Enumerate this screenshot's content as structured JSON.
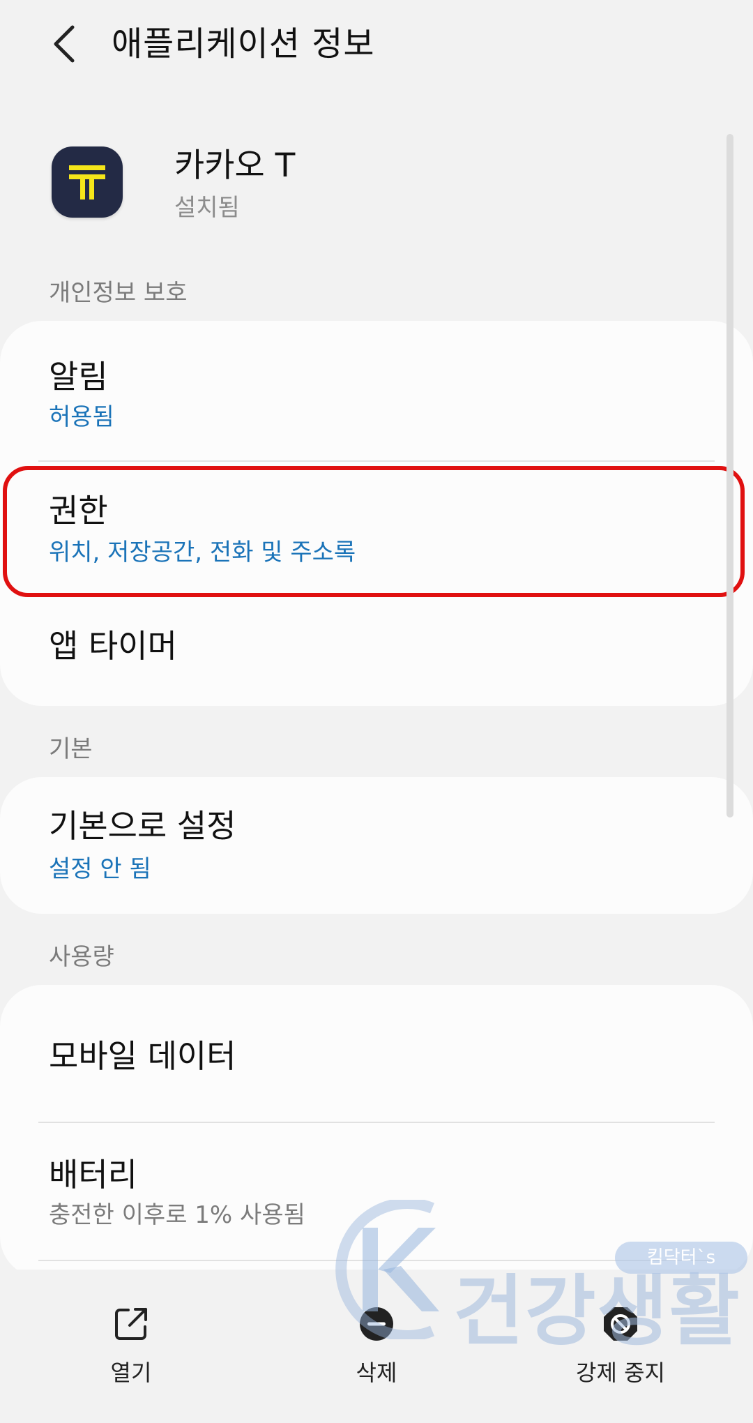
{
  "header": {
    "title": "애플리케이션 정보"
  },
  "app": {
    "name": "카카오 T",
    "status": "설치됨",
    "icon_color": "#232a45",
    "icon_accent": "#f5e61a"
  },
  "sections": {
    "privacy": {
      "label": "개인정보 보호",
      "items": [
        {
          "title": "알림",
          "subtitle": "허용됨"
        },
        {
          "title": "권한",
          "subtitle": "위치, 저장공간, 전화 및 주소록"
        },
        {
          "title": "앱 타이머"
        }
      ]
    },
    "defaults": {
      "label": "기본",
      "items": [
        {
          "title": "기본으로 설정",
          "subtitle": "설정 안 됨"
        }
      ]
    },
    "usage": {
      "label": "사용량",
      "items": [
        {
          "title": "모바일 데이터"
        },
        {
          "title": "배터리",
          "subtitle": "충전한 이후로 1% 사용됨"
        }
      ]
    }
  },
  "bottom_nav": [
    {
      "label": "열기",
      "icon": "open-external-icon"
    },
    {
      "label": "삭제",
      "icon": "uninstall-icon"
    },
    {
      "label": "강제 중지",
      "icon": "force-stop-icon"
    }
  ],
  "watermark": {
    "text": "건강생활",
    "badge": "킴닥터`s"
  },
  "colors": {
    "accent_blue": "#1a73b8",
    "highlight_red": "#e01010"
  }
}
